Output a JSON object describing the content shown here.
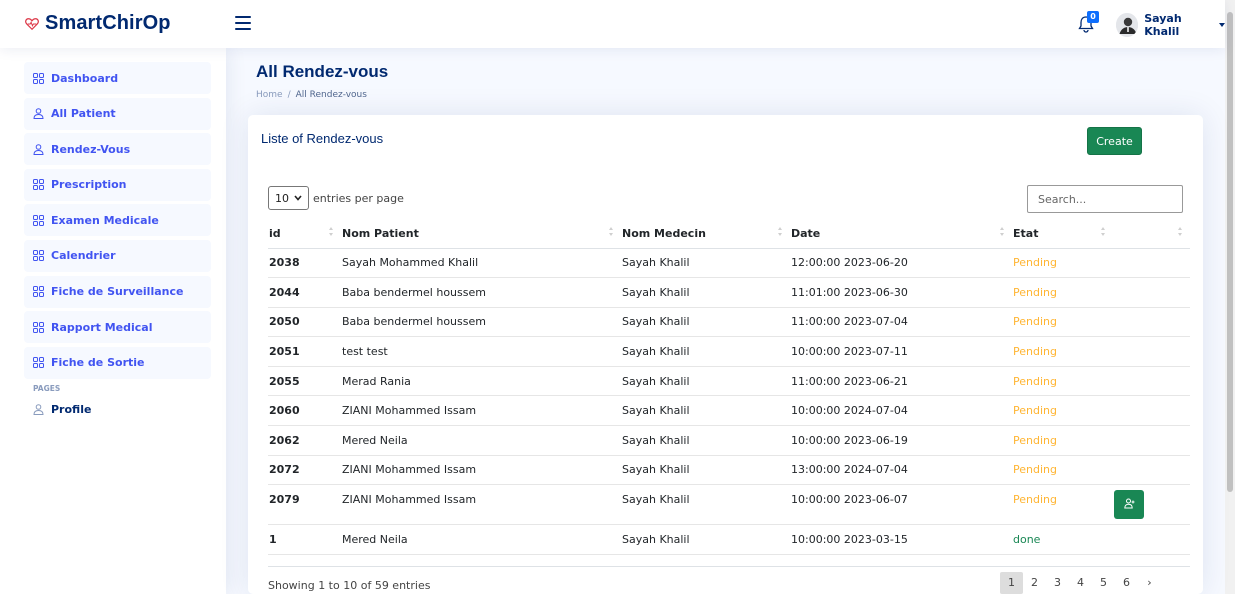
{
  "header": {
    "logo_text": "SmartChirOp",
    "notification_count": "0",
    "user_name": "Sayah Khalil"
  },
  "sidebar": {
    "items": [
      {
        "label": "Dashboard",
        "icon": "grid-icon"
      },
      {
        "label": "All Patient",
        "icon": "person-icon"
      },
      {
        "label": "Rendez-Vous",
        "icon": "person-icon"
      },
      {
        "label": "Prescription",
        "icon": "grid-icon"
      },
      {
        "label": "Examen Medicale",
        "icon": "grid-icon"
      },
      {
        "label": "Calendrier",
        "icon": "grid-icon"
      },
      {
        "label": "Fiche de Surveillance",
        "icon": "grid-icon"
      },
      {
        "label": "Rapport Medical",
        "icon": "grid-icon"
      },
      {
        "label": "Fiche de Sortie",
        "icon": "grid-icon"
      }
    ],
    "pages_heading": "PAGES",
    "profile_label": "Profile"
  },
  "page": {
    "title": "All Rendez-vous",
    "breadcrumb_home": "Home",
    "breadcrumb_sep": "/",
    "breadcrumb_current": "All Rendez-vous"
  },
  "card": {
    "title": "Liste of Rendez-vous",
    "create_label": "Create",
    "entries_value": "10",
    "entries_label": "entries per page",
    "search_placeholder": "Search...",
    "columns": [
      "id",
      "Nom Patient",
      "Nom Medecin",
      "Date",
      "Etat",
      ""
    ],
    "rows": [
      {
        "id": "2038",
        "patient": "Sayah Mohammed Khalil",
        "medecin": "Sayah Khalil",
        "date": "12:00:00 2023-06-20",
        "etat": "Pending"
      },
      {
        "id": "2044",
        "patient": "Baba bendermel houssem",
        "medecin": "Sayah Khalil",
        "date": "11:01:00 2023-06-30",
        "etat": "Pending"
      },
      {
        "id": "2050",
        "patient": "Baba bendermel houssem",
        "medecin": "Sayah Khalil",
        "date": "11:00:00 2023-07-04",
        "etat": "Pending"
      },
      {
        "id": "2051",
        "patient": "test test",
        "medecin": "Sayah Khalil",
        "date": "10:00:00 2023-07-11",
        "etat": "Pending"
      },
      {
        "id": "2055",
        "patient": "Merad Rania",
        "medecin": "Sayah Khalil",
        "date": "11:00:00 2023-06-21",
        "etat": "Pending"
      },
      {
        "id": "2060",
        "patient": "ZIANI Mohammed Issam",
        "medecin": "Sayah Khalil",
        "date": "10:00:00 2024-07-04",
        "etat": "Pending"
      },
      {
        "id": "2062",
        "patient": "Mered Neila",
        "medecin": "Sayah Khalil",
        "date": "10:00:00 2023-06-19",
        "etat": "Pending"
      },
      {
        "id": "2072",
        "patient": "ZIANI Mohammed Issam",
        "medecin": "Sayah Khalil",
        "date": "13:00:00 2024-07-04",
        "etat": "Pending"
      },
      {
        "id": "2079",
        "patient": "ZIANI Mohammed Issam",
        "medecin": "Sayah Khalil",
        "date": "10:00:00 2023-06-07",
        "etat": "Pending"
      },
      {
        "id": "1",
        "patient": "Mered Neila",
        "medecin": "Sayah Khalil",
        "date": "10:00:00 2023-03-15",
        "etat": "done"
      }
    ],
    "footer_info": "Showing 1 to 10 of 59 entries",
    "pages": [
      "1",
      "2",
      "3",
      "4",
      "5",
      "6",
      "›"
    ]
  },
  "colors": {
    "brand": "#012970",
    "accent": "#4154f1",
    "success": "#198754",
    "pending": "#ffb533"
  }
}
